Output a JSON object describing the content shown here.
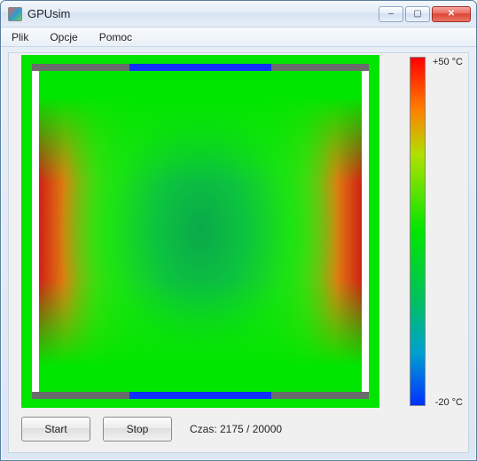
{
  "window": {
    "title": "GPUsim"
  },
  "menu": {
    "file": "Plik",
    "options": "Opcje",
    "help": "Pomoc"
  },
  "legend": {
    "max": "+50 °C",
    "min": "-20 °C"
  },
  "controls": {
    "start": "Start",
    "stop": "Stop"
  },
  "status": {
    "label": "Czas: 2175 / 20000"
  },
  "window_controls": {
    "minimize": "–",
    "maximize": "▢",
    "close": "✕"
  }
}
